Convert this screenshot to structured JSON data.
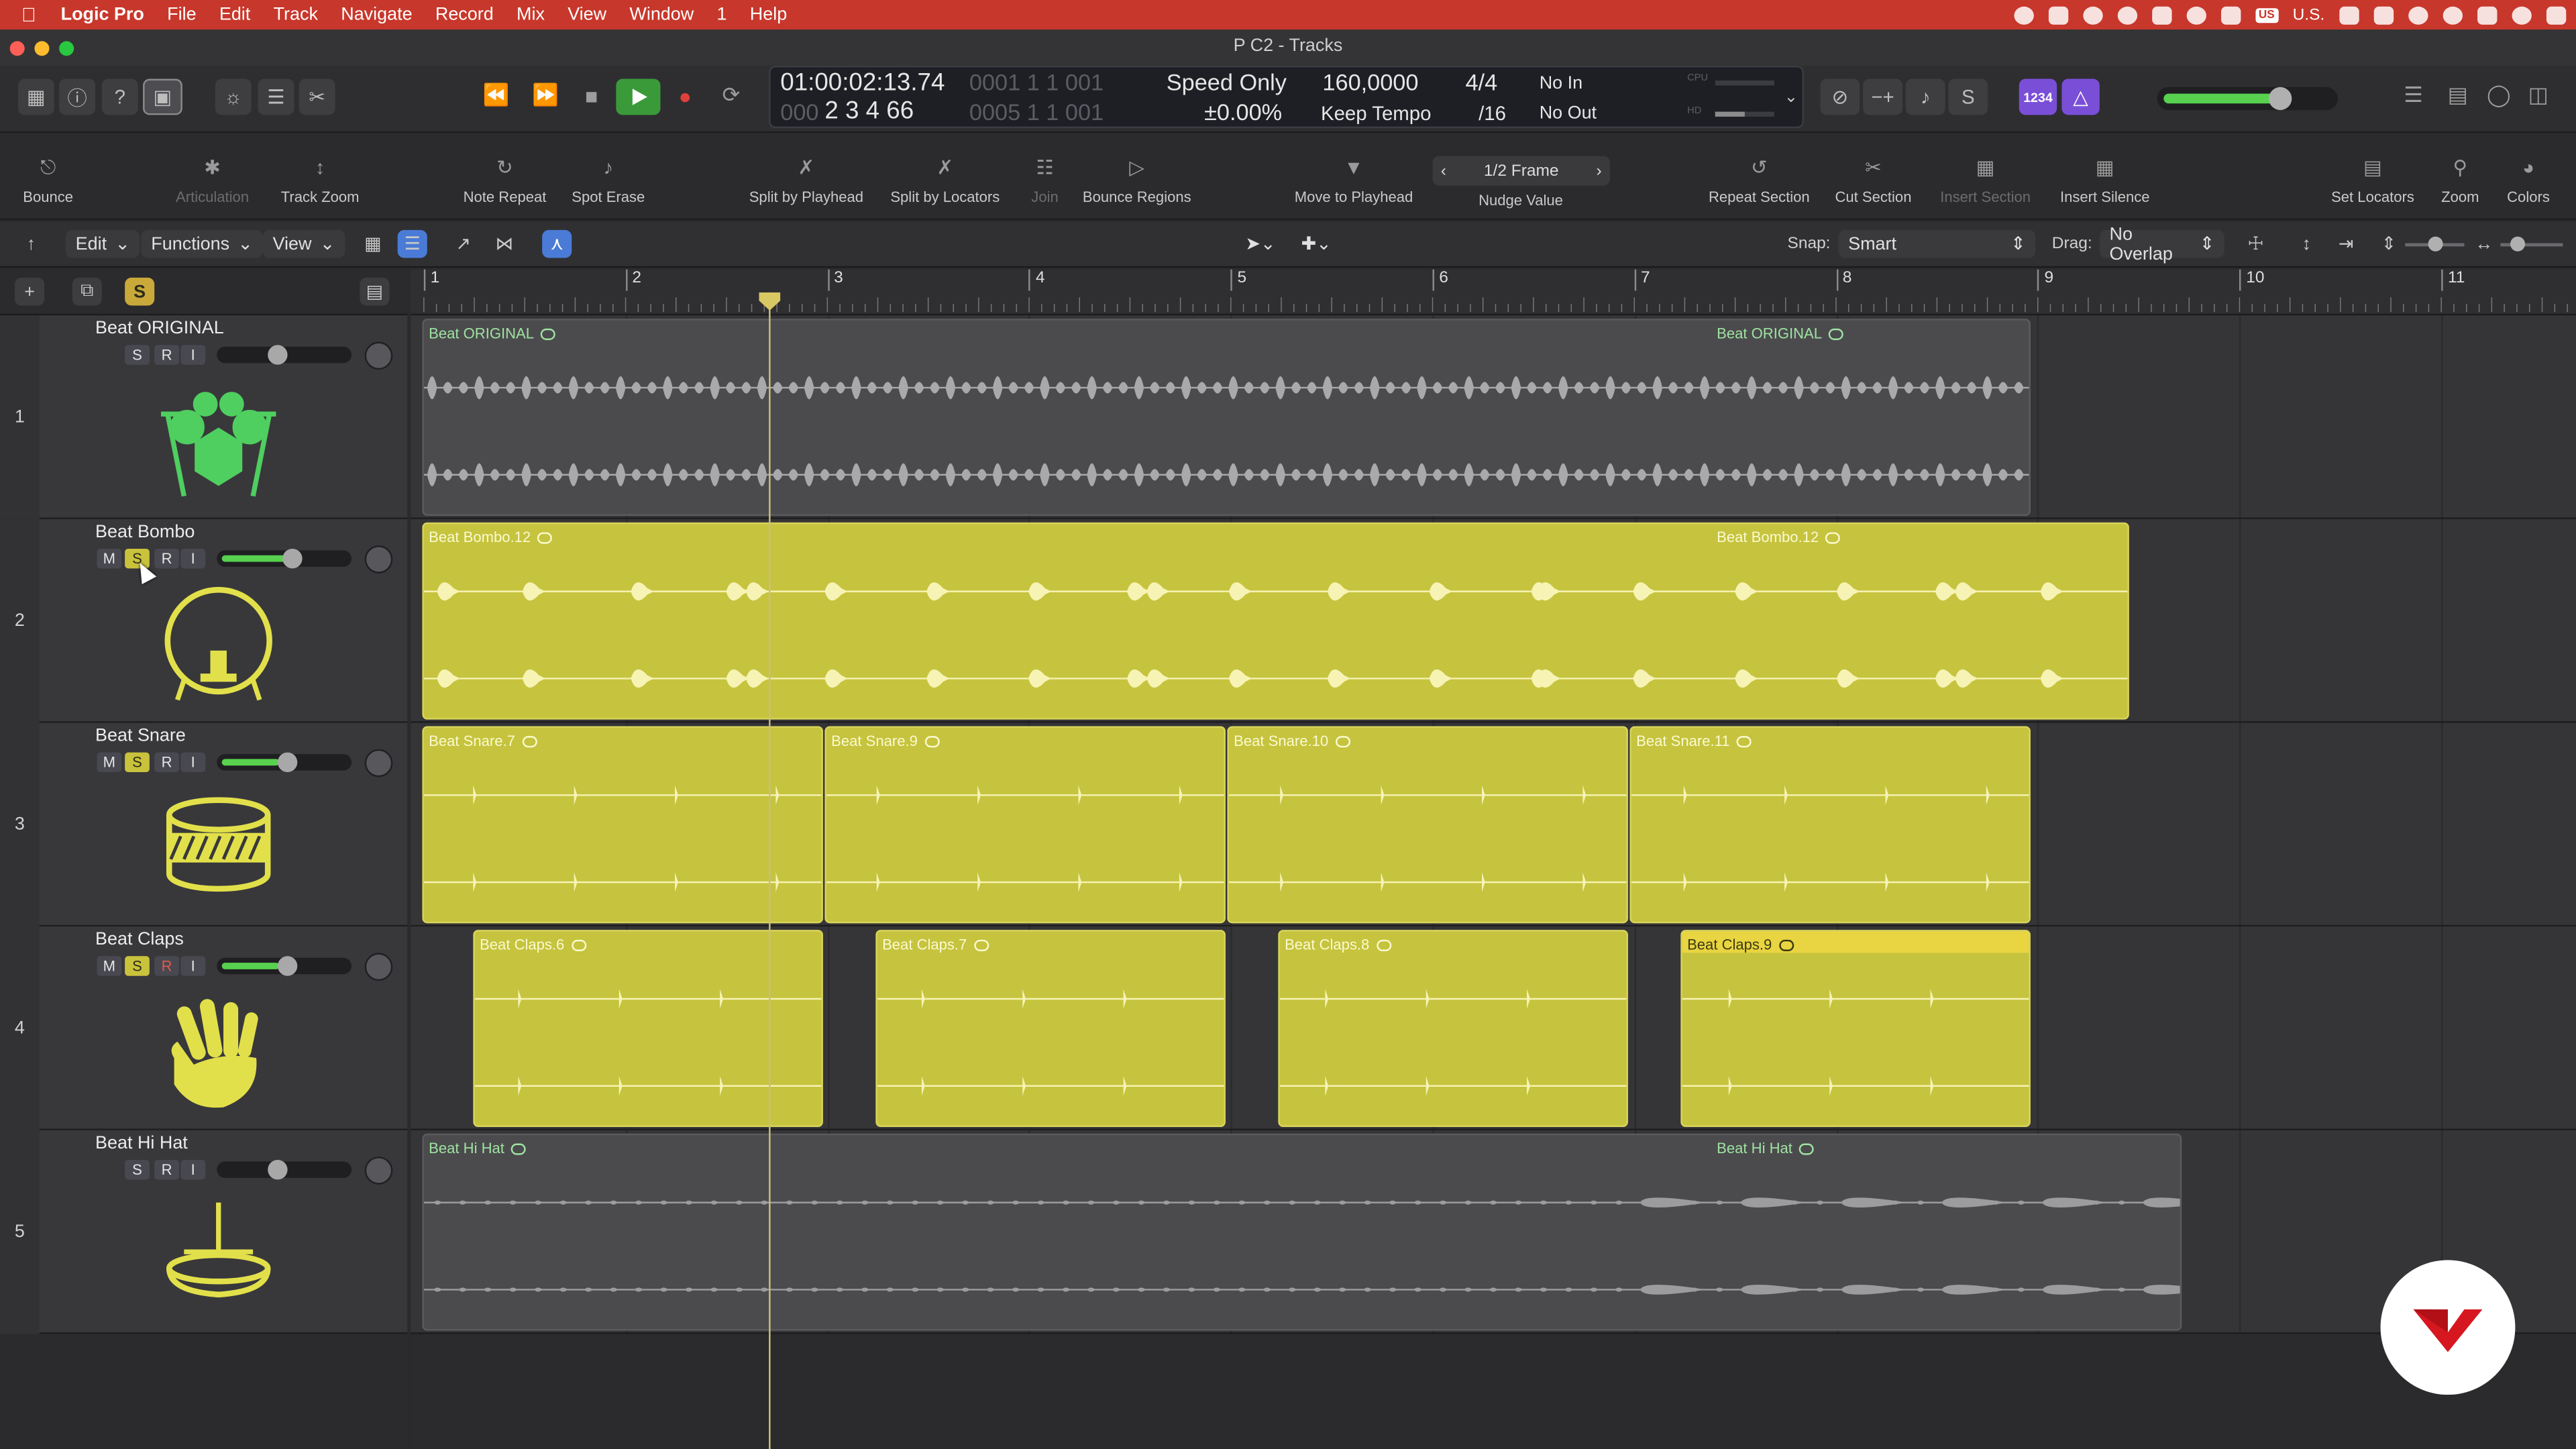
{
  "menubar": {
    "app": "Logic Pro",
    "items": [
      "File",
      "Edit",
      "Track",
      "Navigate",
      "Record",
      "Mix",
      "View",
      "Window",
      "1",
      "Help"
    ],
    "input_source": "U.S."
  },
  "window": {
    "title": "P C2 - Tracks"
  },
  "lcd": {
    "smpte": "01:00:02:13.74",
    "smpte_sub": "0001 1 1 001",
    "position": "2 3 4 66",
    "pos_prefix": "000",
    "pos_suffix": "0005 1 1 001",
    "mode": "Speed Only",
    "varispeed": "±0.00%",
    "tempo": "160,0000",
    "tempo_mode": "Keep Tempo",
    "signature": "4/4",
    "division": "/16",
    "in": "No In",
    "out": "No Out",
    "cpu": "CPU",
    "hd": "HD"
  },
  "control": {
    "badge": "1234"
  },
  "toolbar": [
    {
      "id": "bounce",
      "label": "Bounce",
      "icon": "bounce-icon",
      "enabled": true
    },
    {
      "id": "articulation",
      "label": "Articulation",
      "icon": "articulation-icon",
      "enabled": false
    },
    {
      "id": "track-zoom",
      "label": "Track Zoom",
      "icon": "track-zoom-icon",
      "enabled": true
    },
    {
      "id": "note-repeat",
      "label": "Note Repeat",
      "icon": "note-repeat-icon",
      "enabled": true
    },
    {
      "id": "spot-erase",
      "label": "Spot Erase",
      "icon": "spot-erase-icon",
      "enabled": true
    },
    {
      "id": "split-playhead",
      "label": "Split by Playhead",
      "icon": "split-playhead-icon",
      "enabled": true
    },
    {
      "id": "split-locators",
      "label": "Split by Locators",
      "icon": "split-locators-icon",
      "enabled": true
    },
    {
      "id": "join",
      "label": "Join",
      "icon": "join-icon",
      "enabled": false
    },
    {
      "id": "bounce-regions",
      "label": "Bounce Regions",
      "icon": "bounce-regions-icon",
      "enabled": true
    },
    {
      "id": "move-playhead",
      "label": "Move to Playhead",
      "icon": "move-playhead-icon",
      "enabled": true
    },
    {
      "id": "nudge",
      "label": "Nudge Value",
      "icon": "nudge-icon",
      "enabled": true
    },
    {
      "id": "repeat-section",
      "label": "Repeat Section",
      "icon": "repeat-section-icon",
      "enabled": true
    },
    {
      "id": "cut-section",
      "label": "Cut Section",
      "icon": "cut-section-icon",
      "enabled": true
    },
    {
      "id": "insert-section",
      "label": "Insert Section",
      "icon": "insert-section-icon",
      "enabled": false
    },
    {
      "id": "insert-silence",
      "label": "Insert Silence",
      "icon": "insert-silence-icon",
      "enabled": true
    },
    {
      "id": "set-locators",
      "label": "Set Locators",
      "icon": "set-locators-icon",
      "enabled": true
    },
    {
      "id": "zoom",
      "label": "Zoom",
      "icon": "zoom-icon",
      "enabled": true
    },
    {
      "id": "colors",
      "label": "Colors",
      "icon": "colors-icon",
      "enabled": true
    }
  ],
  "nudge_value": "1/2 Frame",
  "localbar": {
    "edit": "Edit",
    "functions": "Functions",
    "view": "View",
    "snap_label": "Snap:",
    "snap": "Smart",
    "drag_label": "Drag:",
    "drag": "No Overlap"
  },
  "ruler": {
    "bars": [
      "1",
      "2",
      "3",
      "4",
      "5",
      "6",
      "7",
      "8",
      "9",
      "10",
      "11"
    ]
  },
  "tracks": [
    {
      "num": "1",
      "name": "Beat ORIGINAL",
      "icon": "drum-kit-icon",
      "mute": false,
      "solo": false,
      "rec_red": false,
      "fader_level": 0,
      "regions": [
        {
          "label": "Beat ORIGINAL"
        },
        {
          "label": "Beat ORIGINAL"
        }
      ]
    },
    {
      "num": "2",
      "name": "Beat Bombo",
      "icon": "kick-drum-icon",
      "mute": false,
      "solo": true,
      "rec_red": false,
      "fader_level": 0.55,
      "regions": [
        {
          "label": "Beat Bombo.12"
        },
        {
          "label": "Beat Bombo.12"
        }
      ]
    },
    {
      "num": "3",
      "name": "Beat Snare",
      "icon": "snare-drum-icon",
      "mute": false,
      "solo": true,
      "rec_red": false,
      "fader_level": 0.5,
      "regions": [
        {
          "label": "Beat Snare.7"
        },
        {
          "label": "Beat Snare.9"
        },
        {
          "label": "Beat Snare.10"
        },
        {
          "label": "Beat Snare.11"
        }
      ]
    },
    {
      "num": "4",
      "name": "Beat Claps",
      "icon": "hand-clap-icon",
      "mute": false,
      "solo": true,
      "rec_red": true,
      "fader_level": 0.5,
      "regions": [
        {
          "label": "Beat Claps.6"
        },
        {
          "label": "Beat Claps.7"
        },
        {
          "label": "Beat Claps.8"
        },
        {
          "label": "Beat Claps.9"
        }
      ]
    },
    {
      "num": "5",
      "name": "Beat Hi Hat",
      "icon": "hi-hat-icon",
      "mute": false,
      "solo": false,
      "rec_red": false,
      "fader_level": 0,
      "regions": [
        {
          "label": "Beat Hi Hat"
        },
        {
          "label": "Beat Hi Hat"
        }
      ]
    }
  ],
  "colors": {
    "menubar": "#c8372b",
    "region_yellow": "#c6c33e",
    "region_gray": "#4b4b4e",
    "fader_green": "#57d14e",
    "track_icon": "#e2e04a"
  }
}
